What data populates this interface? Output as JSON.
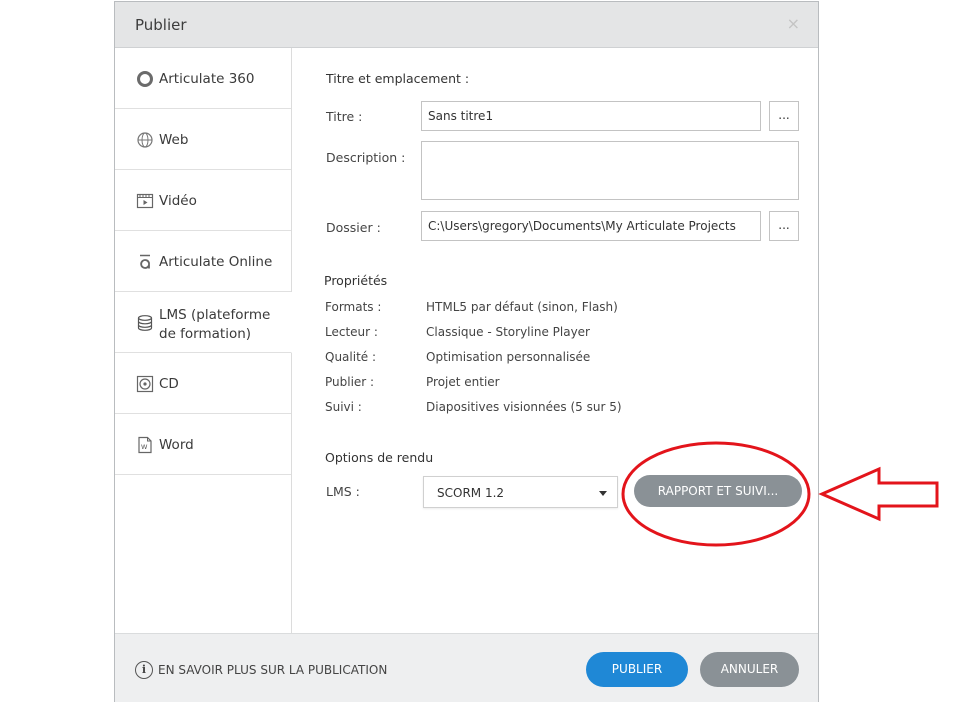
{
  "dialog": {
    "title": "Publier",
    "close_glyph": "×"
  },
  "sidebar": {
    "items": [
      {
        "label": "Articulate 360",
        "icon": "articulate-360-icon"
      },
      {
        "label": "Web",
        "icon": "globe-icon"
      },
      {
        "label": "Vidéo",
        "icon": "video-icon"
      },
      {
        "label": "Articulate Online",
        "icon": "articulate-online-icon"
      },
      {
        "label": "LMS (plateforme de formation)",
        "icon": "database-icon",
        "active": true
      },
      {
        "label": "CD",
        "icon": "cd-icon"
      },
      {
        "label": "Word",
        "icon": "word-document-icon"
      }
    ]
  },
  "location": {
    "section_title": "Titre et emplacement :",
    "title_label": "Titre :",
    "title_value": "Sans titre1",
    "description_label": "Description :",
    "description_value": "",
    "folder_label": "Dossier :",
    "folder_value": "C:\\Users\\gregory\\Documents\\My Articulate Projects",
    "browse_label": "..."
  },
  "properties": {
    "section_title": "Propriétés",
    "rows": [
      {
        "key": "Formats :",
        "value": "HTML5 par défaut (sinon, Flash)"
      },
      {
        "key": "Lecteur :",
        "value": "Classique - Storyline Player"
      },
      {
        "key": "Qualité :",
        "value": "Optimisation personnalisée"
      },
      {
        "key": "Publier :",
        "value": "Projet entier"
      },
      {
        "key": "Suivi :",
        "value": "Diapositives visionnées (5 sur 5)"
      }
    ]
  },
  "output": {
    "section_title": "Options de rendu",
    "lms_label": "LMS :",
    "lms_selected": "SCORM 1.2",
    "report_button": "RAPPORT ET SUIVI..."
  },
  "footer": {
    "info_icon_glyph": "i",
    "info_link": "EN SAVOIR PLUS SUR LA PUBLICATION",
    "publish_button": "PUBLIER",
    "cancel_button": "ANNULER"
  },
  "colors": {
    "primary": "#1f88d6",
    "secondary_button": "#8a9196",
    "annotation_red": "#e3141b"
  }
}
